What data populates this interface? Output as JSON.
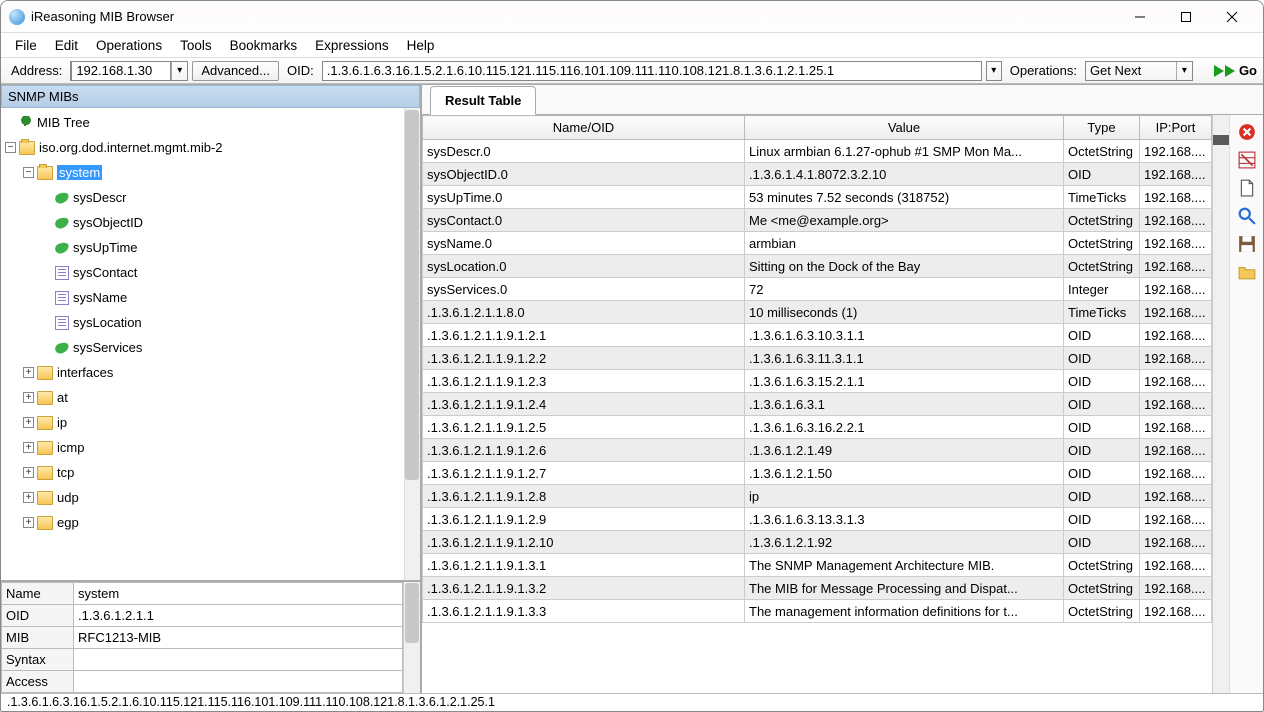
{
  "window": {
    "title": "iReasoning MIB Browser"
  },
  "menu": [
    "File",
    "Edit",
    "Operations",
    "Tools",
    "Bookmarks",
    "Expressions",
    "Help"
  ],
  "toolbar": {
    "address_label": "Address:",
    "address_value": "192.168.1.30",
    "advanced_label": "Advanced...",
    "oid_label": "OID:",
    "oid_value": ".1.3.6.1.6.3.16.1.5.2.1.6.10.115.121.115.116.101.109.111.110.108.121.8.1.3.6.1.2.1.25.1",
    "operations_label": "Operations:",
    "operation_value": "Get Next",
    "go_label": "Go"
  },
  "left": {
    "pane_title": "SNMP MIBs",
    "root": "MIB Tree",
    "mib2": "iso.org.dod.internet.mgmt.mib-2",
    "system": "system",
    "system_children": [
      "sysDescr",
      "sysObjectID",
      "sysUpTime",
      "sysContact",
      "sysName",
      "sysLocation",
      "sysServices"
    ],
    "siblings": [
      "interfaces",
      "at",
      "ip",
      "icmp",
      "tcp",
      "udp",
      "egp"
    ]
  },
  "details": {
    "rows": [
      {
        "k": "Name",
        "v": "system"
      },
      {
        "k": "OID",
        "v": ".1.3.6.1.2.1.1"
      },
      {
        "k": "MIB",
        "v": "RFC1213-MIB"
      },
      {
        "k": "Syntax",
        "v": ""
      },
      {
        "k": "Access",
        "v": ""
      }
    ]
  },
  "result": {
    "tab": "Result Table",
    "cols": [
      "Name/OID",
      "Value",
      "Type",
      "IP:Port"
    ],
    "rows": [
      {
        "n": "sysDescr.0",
        "v": "Linux armbian 6.1.27-ophub #1 SMP Mon Ma...",
        "t": "OctetString",
        "ip": "192.168...."
      },
      {
        "n": "sysObjectID.0",
        "v": ".1.3.6.1.4.1.8072.3.2.10",
        "t": "OID",
        "ip": "192.168...."
      },
      {
        "n": "sysUpTime.0",
        "v": "53 minutes 7.52 seconds (318752)",
        "t": "TimeTicks",
        "ip": "192.168...."
      },
      {
        "n": "sysContact.0",
        "v": "Me <me@example.org>",
        "t": "OctetString",
        "ip": "192.168...."
      },
      {
        "n": "sysName.0",
        "v": "armbian",
        "t": "OctetString",
        "ip": "192.168...."
      },
      {
        "n": "sysLocation.0",
        "v": "Sitting on the Dock of the Bay",
        "t": "OctetString",
        "ip": "192.168...."
      },
      {
        "n": "sysServices.0",
        "v": "72",
        "t": "Integer",
        "ip": "192.168...."
      },
      {
        "n": ".1.3.6.1.2.1.1.8.0",
        "v": "10 milliseconds (1)",
        "t": "TimeTicks",
        "ip": "192.168...."
      },
      {
        "n": ".1.3.6.1.2.1.1.9.1.2.1",
        "v": ".1.3.6.1.6.3.10.3.1.1",
        "t": "OID",
        "ip": "192.168...."
      },
      {
        "n": ".1.3.6.1.2.1.1.9.1.2.2",
        "v": ".1.3.6.1.6.3.11.3.1.1",
        "t": "OID",
        "ip": "192.168...."
      },
      {
        "n": ".1.3.6.1.2.1.1.9.1.2.3",
        "v": ".1.3.6.1.6.3.15.2.1.1",
        "t": "OID",
        "ip": "192.168...."
      },
      {
        "n": ".1.3.6.1.2.1.1.9.1.2.4",
        "v": ".1.3.6.1.6.3.1",
        "t": "OID",
        "ip": "192.168...."
      },
      {
        "n": ".1.3.6.1.2.1.1.9.1.2.5",
        "v": ".1.3.6.1.6.3.16.2.2.1",
        "t": "OID",
        "ip": "192.168...."
      },
      {
        "n": ".1.3.6.1.2.1.1.9.1.2.6",
        "v": ".1.3.6.1.2.1.49",
        "t": "OID",
        "ip": "192.168...."
      },
      {
        "n": ".1.3.6.1.2.1.1.9.1.2.7",
        "v": ".1.3.6.1.2.1.50",
        "t": "OID",
        "ip": "192.168...."
      },
      {
        "n": ".1.3.6.1.2.1.1.9.1.2.8",
        "v": "ip",
        "t": "OID",
        "ip": "192.168...."
      },
      {
        "n": ".1.3.6.1.2.1.1.9.1.2.9",
        "v": ".1.3.6.1.6.3.13.3.1.3",
        "t": "OID",
        "ip": "192.168...."
      },
      {
        "n": ".1.3.6.1.2.1.1.9.1.2.10",
        "v": ".1.3.6.1.2.1.92",
        "t": "OID",
        "ip": "192.168...."
      },
      {
        "n": ".1.3.6.1.2.1.1.9.1.3.1",
        "v": "The SNMP Management Architecture MIB.",
        "t": "OctetString",
        "ip": "192.168...."
      },
      {
        "n": ".1.3.6.1.2.1.1.9.1.3.2",
        "v": "The MIB for Message Processing and Dispat...",
        "t": "OctetString",
        "ip": "192.168...."
      },
      {
        "n": ".1.3.6.1.2.1.1.9.1.3.3",
        "v": "The management information definitions for t...",
        "t": "OctetString",
        "ip": "192.168...."
      }
    ]
  },
  "status": ".1.3.6.1.6.3.16.1.5.2.1.6.10.115.121.115.116.101.109.111.110.108.121.8.1.3.6.1.2.1.25.1"
}
